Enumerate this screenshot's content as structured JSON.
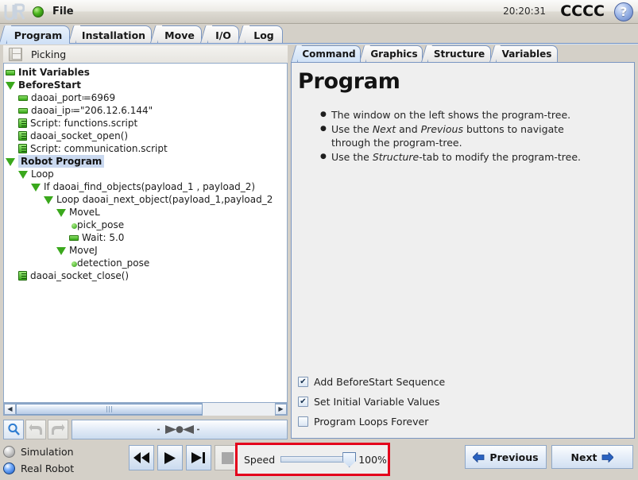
{
  "titlebar": {
    "logo_name": "ur-logo",
    "status_icon": "green-sphere-icon",
    "file_menu": "File",
    "clock": "20:20:31",
    "robot_name": "CCCC",
    "help": "?"
  },
  "main_tabs": [
    {
      "label": "Program",
      "selected": true
    },
    {
      "label": "Installation",
      "selected": false
    },
    {
      "label": "Move",
      "selected": false
    },
    {
      "label": "I/O",
      "selected": false
    },
    {
      "label": "Log",
      "selected": false
    }
  ],
  "program": {
    "save_icon": "floppy-disk-icon",
    "name": "Picking"
  },
  "tree": [
    {
      "label": "Init Variables",
      "depth": 0,
      "icon": "var",
      "bold": true,
      "selected": false
    },
    {
      "label": "BeforeStart",
      "depth": 0,
      "icon": "tri",
      "bold": true,
      "selected": false
    },
    {
      "label": "daoai_port≔6969",
      "depth": 1,
      "icon": "var",
      "bold": false,
      "selected": false
    },
    {
      "label": "daoai_ip≔\"206.12.6.144\"",
      "depth": 1,
      "icon": "var",
      "bold": false,
      "selected": false
    },
    {
      "label": "Script: functions.script",
      "depth": 1,
      "icon": "script",
      "bold": false,
      "selected": false
    },
    {
      "label": "daoai_socket_open()",
      "depth": 1,
      "icon": "script",
      "bold": false,
      "selected": false
    },
    {
      "label": "Script: communication.script",
      "depth": 1,
      "icon": "script",
      "bold": false,
      "selected": false
    },
    {
      "label": "Robot Program",
      "depth": 0,
      "icon": "tri",
      "bold": true,
      "selected": true
    },
    {
      "label": "Loop",
      "depth": 1,
      "icon": "tri",
      "bold": false,
      "selected": false
    },
    {
      "label": "If daoai_find_objects(payload_1 , payload_2)",
      "depth": 2,
      "icon": "tri",
      "bold": false,
      "selected": false
    },
    {
      "label": "Loop daoai_next_object(payload_1,payload_2",
      "depth": 3,
      "icon": "tri",
      "bold": false,
      "selected": false
    },
    {
      "label": "MoveL",
      "depth": 4,
      "icon": "tri",
      "bold": false,
      "selected": false
    },
    {
      "label": "pick_pose",
      "depth": 5,
      "icon": "dot",
      "bold": false,
      "selected": false
    },
    {
      "label": "Wait: 5.0",
      "depth": 5,
      "icon": "var",
      "bold": false,
      "selected": false
    },
    {
      "label": "MoveJ",
      "depth": 4,
      "icon": "tri",
      "bold": false,
      "selected": false
    },
    {
      "label": "detection_pose",
      "depth": 5,
      "icon": "dot",
      "bold": false,
      "selected": false
    },
    {
      "label": "daoai_socket_close()",
      "depth": 1,
      "icon": "script",
      "bold": false,
      "selected": false
    }
  ],
  "toolbar": {
    "search_icon": "magnifier-icon",
    "undo_icon": "undo-arrow-icon",
    "redo_icon": "redo-arrow-icon",
    "step_indicator": "step-position-indicator"
  },
  "status": {
    "simulation_label": "Simulation",
    "real_robot_label": "Real Robot",
    "selected_mode": "Real Robot",
    "transport": [
      {
        "name": "rewind-button",
        "icon": "rewind-icon",
        "enabled": true
      },
      {
        "name": "play-button",
        "icon": "play-icon",
        "enabled": true
      },
      {
        "name": "step-button",
        "icon": "step-forward-icon",
        "enabled": true
      },
      {
        "name": "stop-button",
        "icon": "stop-icon",
        "enabled": false
      }
    ],
    "speed_label": "Speed",
    "speed_value": "100%",
    "speed_percent": 100,
    "highlight_color": "#e4001b",
    "previous_label": "Previous",
    "next_label": "Next"
  },
  "right_tabs": [
    {
      "label": "Command",
      "selected": true
    },
    {
      "label": "Graphics",
      "selected": false
    },
    {
      "label": "Structure",
      "selected": false
    },
    {
      "label": "Variables",
      "selected": false
    }
  ],
  "command_panel": {
    "title": "Program",
    "bullets": [
      {
        "parts": [
          {
            "t": "The window on the left shows the program-tree.",
            "i": false
          }
        ]
      },
      {
        "parts": [
          {
            "t": "Use the ",
            "i": false
          },
          {
            "t": "Next",
            "i": true
          },
          {
            "t": " and ",
            "i": false
          },
          {
            "t": "Previous",
            "i": true
          },
          {
            "t": " buttons to navigate through the program-tree.",
            "i": false
          }
        ]
      },
      {
        "parts": [
          {
            "t": "Use the ",
            "i": false
          },
          {
            "t": "Structure",
            "i": true
          },
          {
            "t": "-tab to modify the program-tree.",
            "i": false
          }
        ]
      }
    ],
    "checkboxes": [
      {
        "label": "Add BeforeStart Sequence",
        "checked": true
      },
      {
        "label": "Set Initial Variable Values",
        "checked": true
      },
      {
        "label": "Program Loops Forever",
        "checked": false
      }
    ]
  }
}
